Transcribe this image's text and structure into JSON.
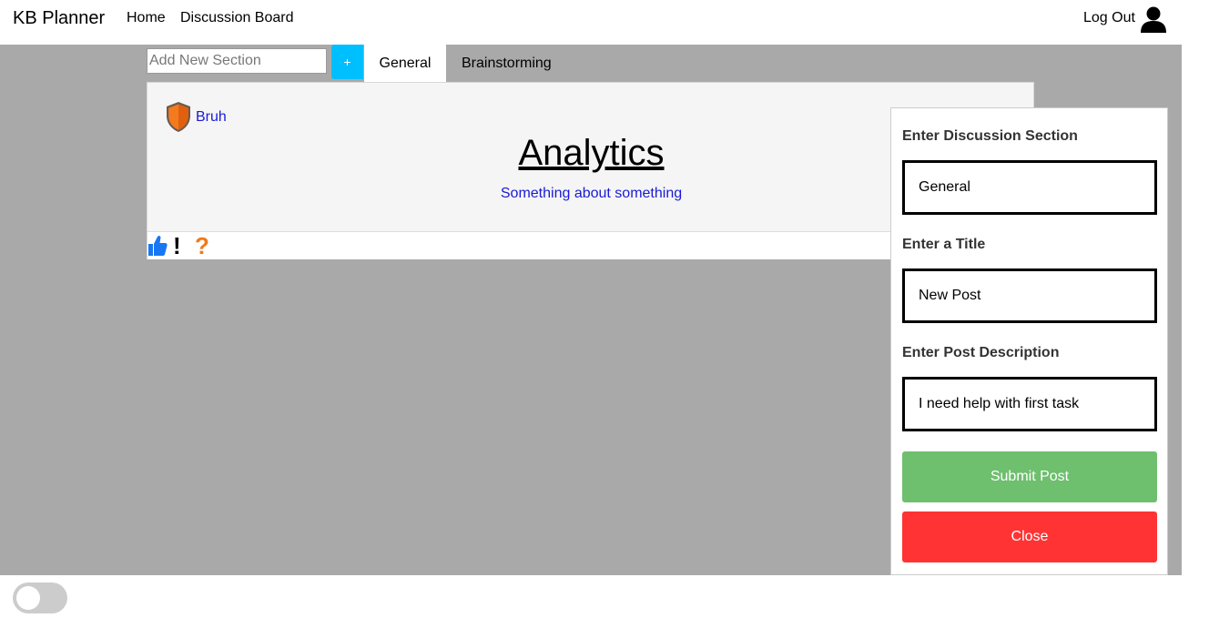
{
  "navbar": {
    "brand": "KB Planner",
    "links": [
      "Home",
      "Discussion Board"
    ],
    "logout_label": "Log Out",
    "user_icon": "user-icon"
  },
  "sections": {
    "add_placeholder": "Add New Section",
    "add_button_label": "+",
    "tabs": [
      {
        "label": "General",
        "active": true
      },
      {
        "label": "Brainstorming",
        "active": false
      }
    ]
  },
  "post": {
    "author": "Bruh",
    "author_icon": "shield-icon",
    "title": "Analytics",
    "description": "Something about something",
    "reactions": {
      "like_icon": "thumbs-up-icon",
      "exclaim": "!",
      "question": "?"
    }
  },
  "form": {
    "section_label": "Enter Discussion Section",
    "section_value": "General",
    "title_label": "Enter a Title",
    "title_value": "New Post",
    "description_label": "Enter Post Description",
    "description_value": "I need help with first task",
    "submit_label": "Submit Post",
    "close_label": "Close"
  },
  "colors": {
    "main_bg": "#a9a9a9",
    "add_button": "#00bfff",
    "link_blue": "#1a1ad6",
    "submit_green": "#6ebf6e",
    "close_red": "#ff3333",
    "question_orange": "#f07a1a"
  },
  "toggle": {
    "on": false
  }
}
